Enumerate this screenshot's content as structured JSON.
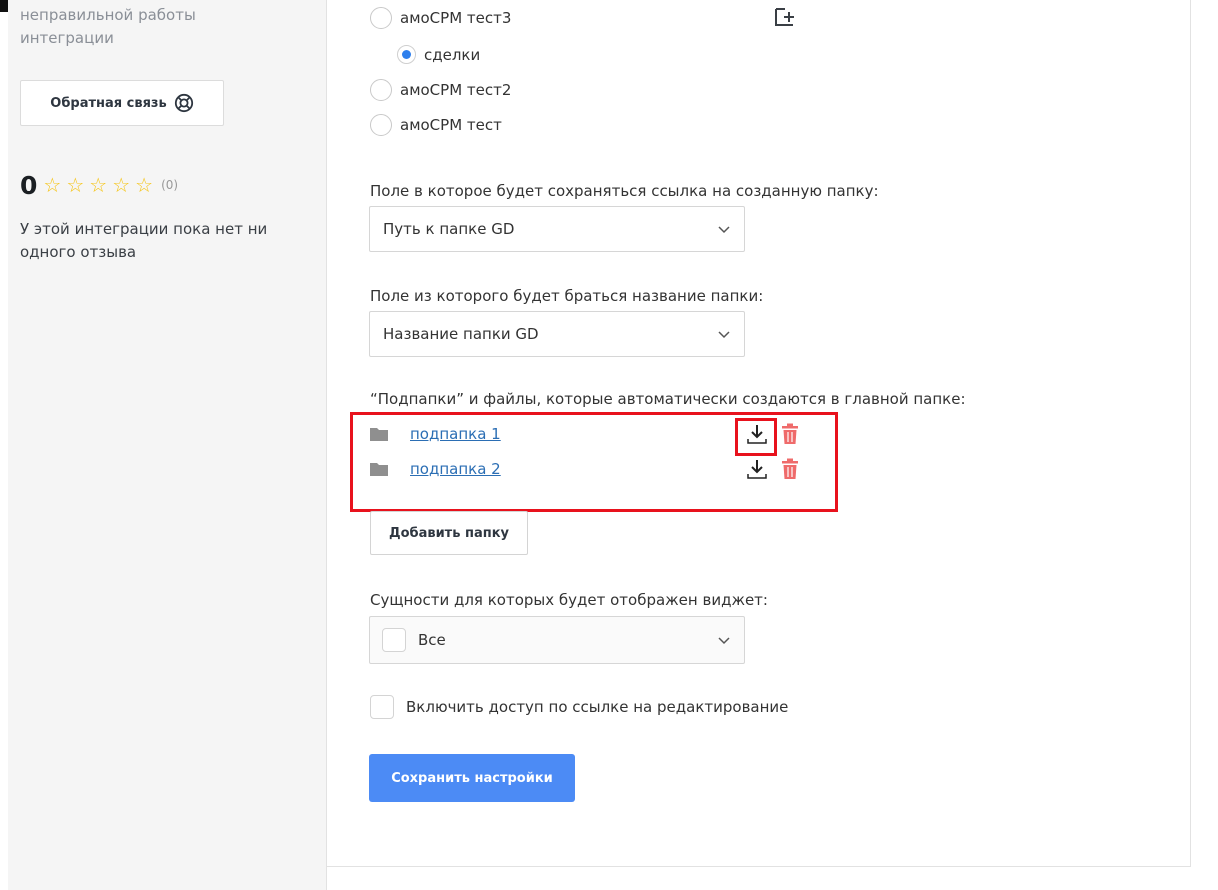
{
  "sidebar": {
    "note": "неправильной работы интеграции",
    "feedback_label": "Обратная связь",
    "rating_value": "0",
    "stars_filled": 0,
    "stars_total": 5,
    "rating_count": "(0)",
    "no_reviews": "У этой интеграции пока нет ни одного отзыва"
  },
  "pipelines": [
    {
      "label": "амоСРМ тест3",
      "checked": false,
      "indent": false
    },
    {
      "label": "сделки",
      "checked": true,
      "indent": true
    },
    {
      "label": "амоСРМ тест2",
      "checked": false,
      "indent": false
    },
    {
      "label": "амоСРМ тест",
      "checked": false,
      "indent": false
    }
  ],
  "link_field": {
    "label": "Поле в которое будет сохраняться ссылка на созданную папку:",
    "value": "Путь к папке GD"
  },
  "name_field": {
    "label": "Поле из которого будет браться название папки:",
    "value": "Название папки GD"
  },
  "subfolders": {
    "label": "“Подпапки” и файлы, которые автоматически создаются в главной папке:",
    "items": [
      "подпапка 1",
      "подпапка 2"
    ],
    "add_button": "Добавить папку"
  },
  "entities": {
    "label": "Сущности для которых будет отображен виджет:",
    "value": "Все"
  },
  "edit_access": {
    "label": "Включить доступ по ссылке на редактирование",
    "checked": false
  },
  "save_button": "Сохранить настройки",
  "colors": {
    "accent": "#4c8bf5",
    "highlight": "#e8121d",
    "link": "#2b6eb4",
    "star": "#f5c518",
    "trash": "#ef6b6b"
  }
}
